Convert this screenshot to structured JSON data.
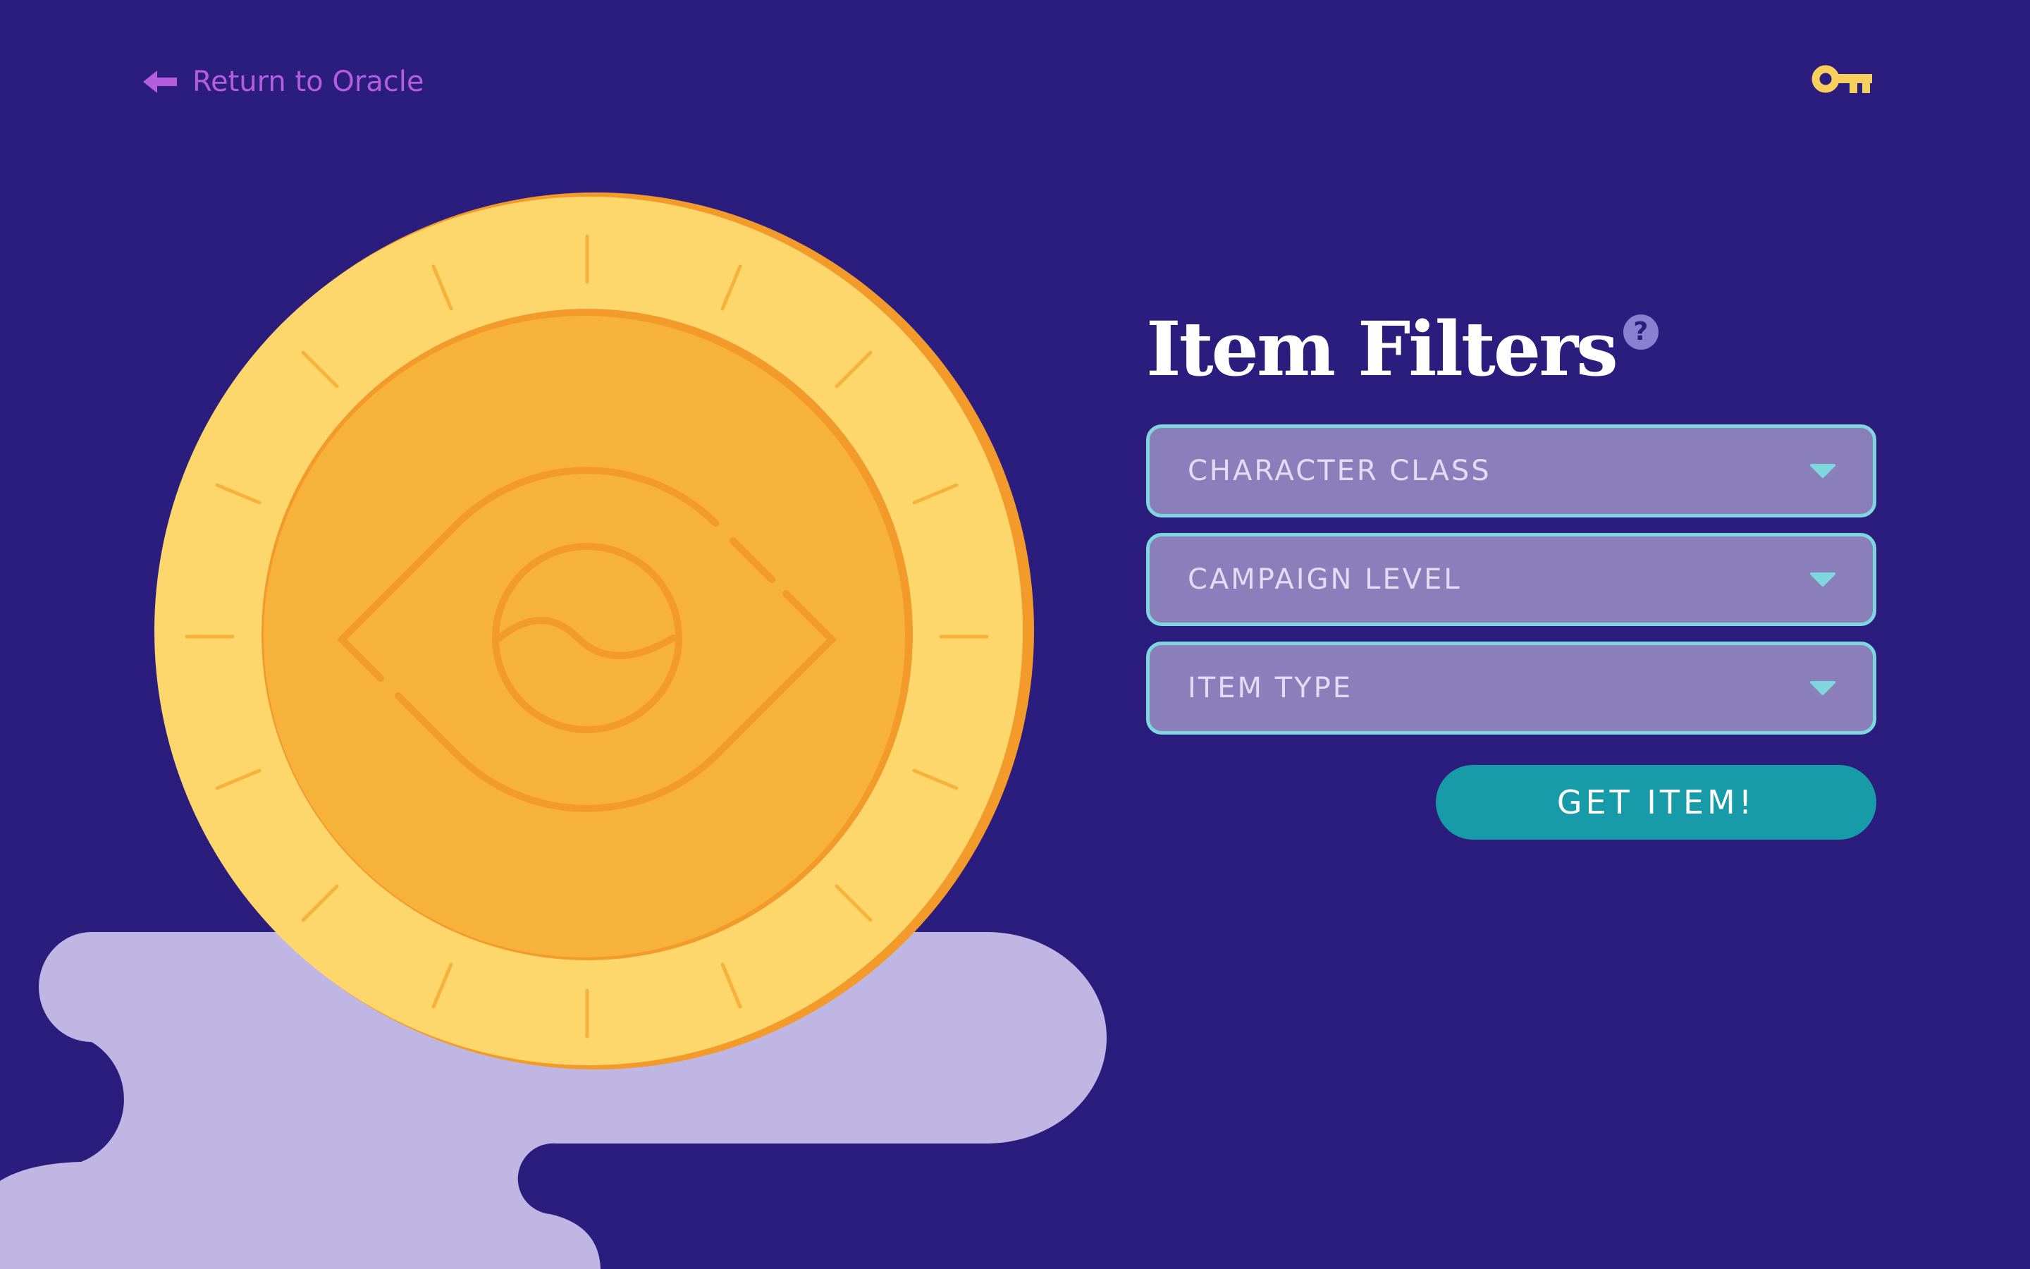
{
  "nav": {
    "back_label": "Return to Oracle",
    "back_icon": "arrow-left-icon",
    "key_icon": "key-icon"
  },
  "filters": {
    "title": "Item Filters",
    "help_symbol": "?",
    "items": [
      {
        "label": "CHARACTER CLASS"
      },
      {
        "label": "CAMPAIGN LEVEL"
      },
      {
        "label": "ITEM TYPE"
      }
    ],
    "submit_label": "GET ITEM!"
  },
  "colors": {
    "background": "#2b1d7d",
    "link": "#b45ede",
    "key": "#f6cf5c",
    "coin_outer": "#fdd76b",
    "coin_inner": "#f6b23a",
    "coin_line": "#f39b2a",
    "cloud": "#bfb6e3",
    "dropdown_fill": "#8a7fbb",
    "dropdown_border": "#7fd6dc",
    "button": "#179ba8"
  }
}
